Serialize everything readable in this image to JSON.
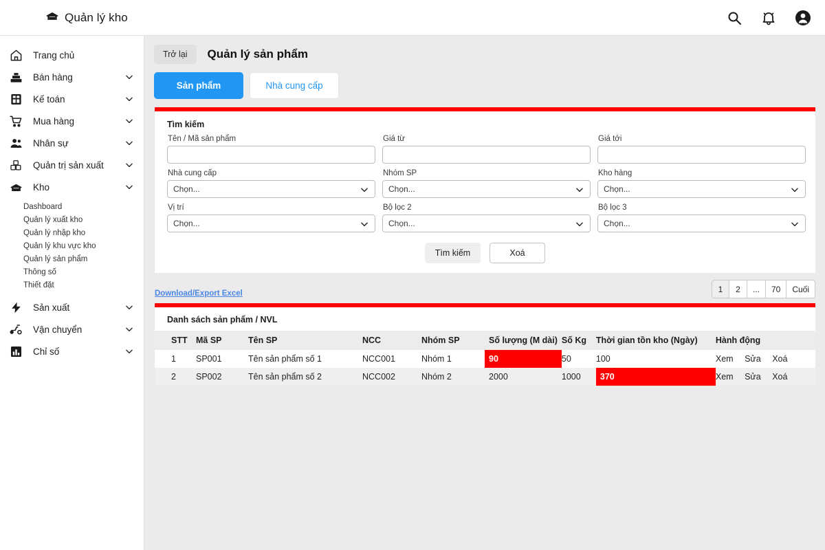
{
  "topbar": {
    "brand": "Quản lý kho",
    "brand_icon": "warehouse-icon",
    "icons": [
      {
        "name": "search-icon"
      },
      {
        "name": "notification-bell-icon"
      },
      {
        "name": "account-circle-icon"
      }
    ]
  },
  "sidebar": {
    "items": [
      {
        "label": "Trang chủ",
        "icon": "home-icon",
        "caret": false
      },
      {
        "label": "Bán hàng",
        "icon": "cash-register-icon",
        "caret": true
      },
      {
        "label": "Kế toán",
        "icon": "calculator-icon",
        "caret": true
      },
      {
        "label": "Mua hàng",
        "icon": "shopping-cart-icon",
        "caret": true
      },
      {
        "label": "Nhân sự",
        "icon": "people-icon",
        "caret": true
      },
      {
        "label": "Quản trị sản xuất",
        "icon": "production-boxes-icon",
        "caret": true
      },
      {
        "label": "Kho",
        "icon": "warehouse-icon",
        "caret": true
      },
      {
        "label": "Sản xuất",
        "icon": "bolt-icon",
        "caret": true
      },
      {
        "label": "Vận chuyển",
        "icon": "delivery-scooter-icon",
        "caret": true
      },
      {
        "label": "Chỉ số",
        "icon": "bar-chart-icon",
        "caret": true
      }
    ],
    "kho_submenu": [
      "Dashboard",
      "Quản lý xuất kho",
      "Quản lý nhập kho",
      "Quản lý khu vực kho",
      "Quản lý sản phẩm",
      "Thông số",
      "Thiết đặt"
    ]
  },
  "page": {
    "back_label": "Trở lại",
    "title": "Quản lý sản phẩm",
    "tabs": [
      {
        "label": "Sản phẩm",
        "active": true
      },
      {
        "label": "Nhà cung cấp",
        "active": false
      }
    ],
    "accent_color": "#ff0000",
    "primary_color": "#2196f3"
  },
  "search": {
    "title": "Tìm kiếm",
    "fields": [
      {
        "label": "Tên / Mã sản phẩm",
        "type": "text",
        "value": "",
        "placeholder": ""
      },
      {
        "label": "Giá từ",
        "type": "text",
        "value": "",
        "placeholder": ""
      },
      {
        "label": "Giá tới",
        "type": "text",
        "value": "",
        "placeholder": ""
      },
      {
        "label": "Nhà cung cấp",
        "type": "select",
        "value": "Chọn..."
      },
      {
        "label": "Nhóm SP",
        "type": "select",
        "value": "Chọn..."
      },
      {
        "label": "Kho hàng",
        "type": "select",
        "value": "Chọn..."
      },
      {
        "label": "Vị trí",
        "type": "select",
        "value": "Chọn..."
      },
      {
        "label": "Bộ lọc 2",
        "type": "select",
        "value": "Chọn..."
      },
      {
        "label": "Bộ lọc 3",
        "type": "select",
        "value": "Chọn..."
      }
    ],
    "search_button": "Tìm kiếm",
    "clear_button": "Xoá"
  },
  "toolbar": {
    "export_link": "Download/Export Excel",
    "pagination": [
      "1",
      "2",
      "...",
      "70",
      "Cuối"
    ],
    "pagination_active": "1"
  },
  "table": {
    "title": "Danh sách sản phẩm / NVL",
    "columns": [
      "STT",
      "Mã SP",
      "Tên SP",
      "NCC",
      "Nhóm SP",
      "Số lượng (M dài)",
      "Số Kg",
      "Thời gian tồn kho (Ngày)",
      "Hành động"
    ],
    "actions": [
      "Xem",
      "Sửa",
      "Xoá"
    ],
    "rows": [
      {
        "stt": "1",
        "ma_sp": "SP001",
        "ten_sp": "Tên sản phẩm số 1",
        "ncc": "NCC001",
        "nhom_sp": "Nhóm 1",
        "so_luong": "90",
        "so_kg": "50",
        "thoi_gian": "100",
        "so_luong_highlight": true,
        "thoi_gian_highlight": false
      },
      {
        "stt": "2",
        "ma_sp": "SP002",
        "ten_sp": "Tên sản phẩm số 2",
        "ncc": "NCC002",
        "nhom_sp": "Nhóm 2",
        "so_luong": "2000",
        "so_kg": "1000",
        "thoi_gian": "370",
        "so_luong_highlight": false,
        "thoi_gian_highlight": true
      }
    ]
  }
}
